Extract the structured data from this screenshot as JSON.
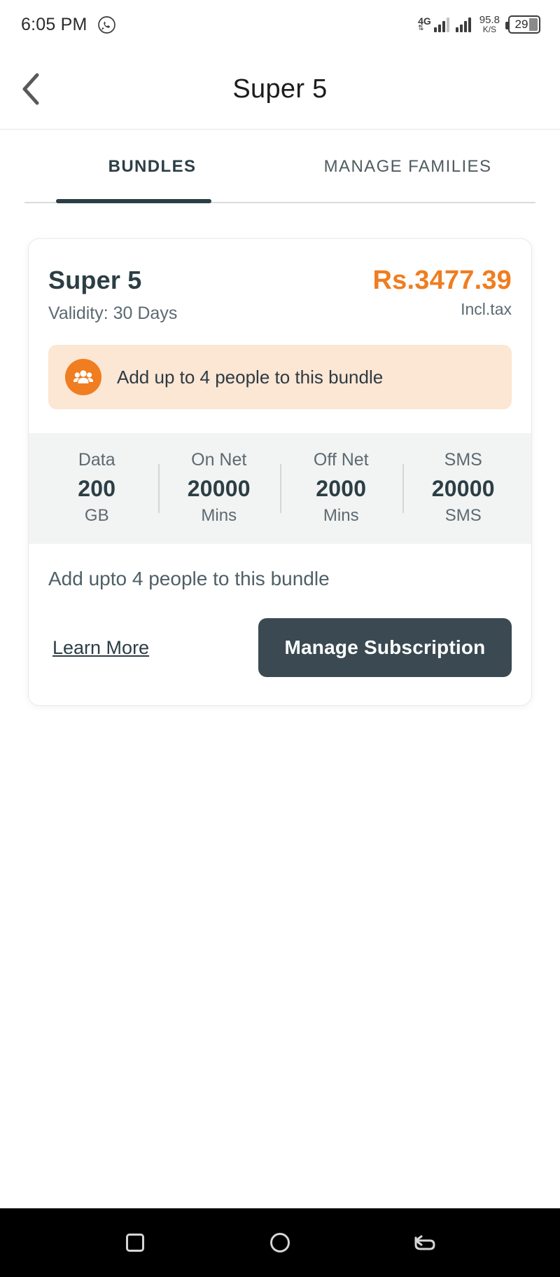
{
  "status_bar": {
    "time": "6:05 PM",
    "whatsapp_icon": "whatsapp-icon",
    "network_type": "4G",
    "data_arrows": "⇅",
    "data_speed_value": "95.8",
    "data_speed_unit": "K/S",
    "battery_percent": "29"
  },
  "app_bar": {
    "back_icon": "chevron-left-icon",
    "title": "Super 5"
  },
  "tabs": [
    {
      "label": "BUNDLES",
      "active": true
    },
    {
      "label": "MANAGE FAMILIES",
      "active": false
    }
  ],
  "bundle_card": {
    "name": "Super 5",
    "validity": "Validity: 30 Days",
    "price": "Rs.3477.39",
    "tax_note": "Incl.tax",
    "promo": {
      "icon": "people-group-icon",
      "text": "Add up to 4 people to this bundle"
    },
    "stats": [
      {
        "label": "Data",
        "value": "200",
        "unit": "GB"
      },
      {
        "label": "On Net",
        "value": "20000",
        "unit": "Mins"
      },
      {
        "label": "Off Net",
        "value": "2000",
        "unit": "Mins"
      },
      {
        "label": "SMS",
        "value": "20000",
        "unit": "SMS"
      }
    ],
    "footer_note": "Add upto 4 people to this bundle",
    "learn_more_label": "Learn More",
    "manage_button_label": "Manage Subscription"
  },
  "nav_bar": {
    "recents_icon": "square-icon",
    "home_icon": "circle-icon",
    "back_icon": "back-arrow-icon"
  },
  "colors": {
    "accent_orange": "#f07d20",
    "promo_background": "#fce6d4",
    "dark_slate": "#2c3e45",
    "button_dark": "#3b4a52",
    "stats_background": "#f2f3f3"
  }
}
